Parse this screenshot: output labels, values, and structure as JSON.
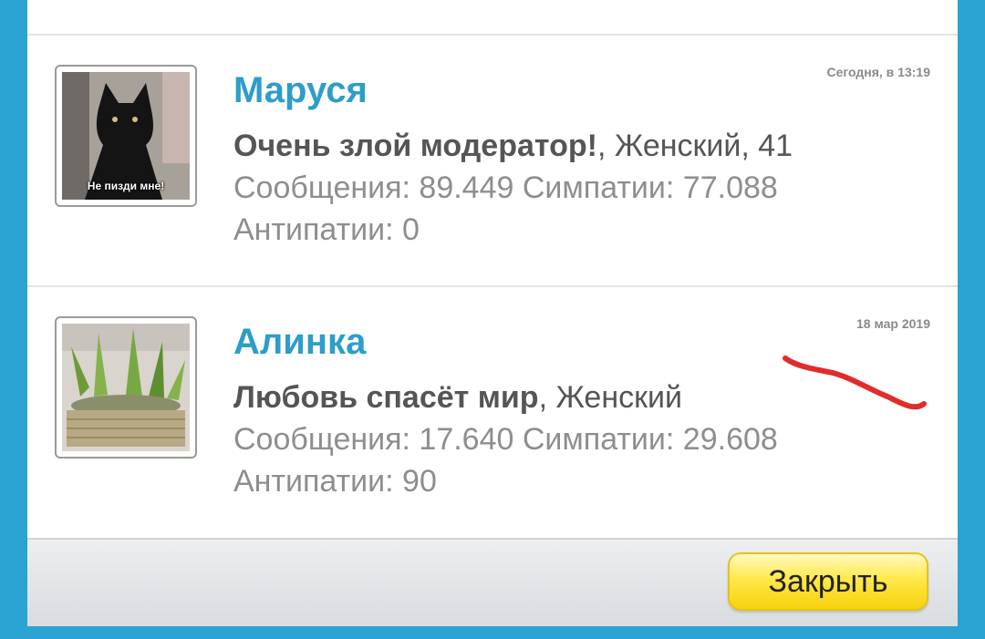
{
  "users": [
    {
      "name": "Маруся",
      "date": "Сегодня, в 13:19",
      "title": "Очень злой модератор!",
      "details": ", Женский, 41",
      "stats": "Сообщения: 89.449 Симпатии: 77.088",
      "antipathy": "Антипатии: 0",
      "avatar_caption": "Не пизди мне!"
    },
    {
      "name": "Алинка",
      "date": "18 мар 2019",
      "title": "Любовь спасёт мир",
      "details": ", Женский",
      "stats": "Сообщения: 17.640 Симпатии: 29.608",
      "antipathy": "Антипатии: 90"
    }
  ],
  "footer": {
    "close_label": "Закрыть"
  },
  "colors": {
    "name": "#2d9dc9",
    "background": "#2ba3d2",
    "button": "#ffe94a",
    "scribble": "#e22b2b"
  }
}
